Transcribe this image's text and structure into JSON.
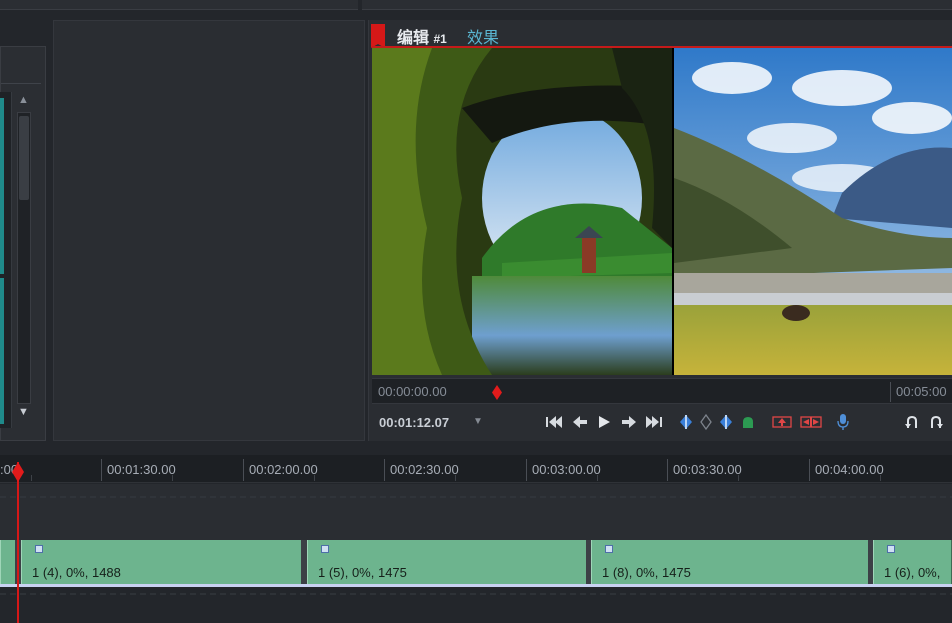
{
  "preview": {
    "title": "编辑",
    "title_number": "#1",
    "tab_effects": "效果",
    "ruler_start": "00:00:00.00",
    "ruler_end": "00:05:00",
    "current_time": "00:01:12.07"
  },
  "toolbar": {
    "icons": [
      "skip-to-start-icon",
      "step-back-icon",
      "play-icon",
      "step-forward-icon",
      "skip-to-end-icon",
      "mark-in-icon",
      "marker-icon",
      "mark-out-icon",
      "snapshot-icon",
      "lift-icon",
      "extract-icon",
      "microphone-icon",
      "undo-icon",
      "redo-icon"
    ]
  },
  "timeline": {
    "ticks": [
      "00:01:30.00",
      "00:02:00.00",
      "00:02:30.00",
      "00:03:00.00",
      "00:03:30.00",
      "00:04:00.00"
    ],
    "partial_tick": ":00",
    "clips": [
      {
        "label": "1 (4), 0%, 1488"
      },
      {
        "label": "1 (5), 0%, 1475"
      },
      {
        "label": "1 (8), 0%, 1475"
      },
      {
        "label": "1 (6), 0%,"
      }
    ]
  },
  "colors": {
    "accent_red": "#d51818",
    "tab_blue": "#5ab6d2",
    "clip_green": "#6db48e"
  }
}
